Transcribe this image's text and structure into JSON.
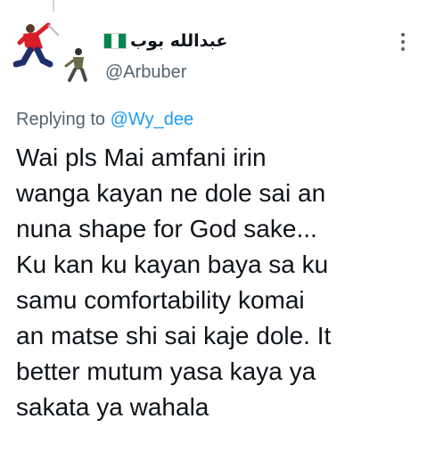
{
  "author": {
    "display_name": "عبدالله بوب",
    "flag_icon": "nigeria-flag-icon",
    "handle": "@Arbuber",
    "avatar_icon": "avatar-illustration-icon"
  },
  "menu": {
    "icon": "more-options-icon"
  },
  "reply_context": {
    "prefix": "Replying to",
    "mention": "@Wy_dee"
  },
  "tweet": {
    "lines": [
      "Wai pls Mai amfani irin",
      "wanga kayan ne dole sai an",
      "nuna shape for God sake...",
      "Ku kan ku kayan baya sa ku",
      "samu comfortability komai",
      "an matse shi sai kaje dole. It",
      "better mutum yasa kaya ya",
      "sakata ya wahala"
    ]
  },
  "colors": {
    "text_primary": "#0f1419",
    "text_secondary": "#536471",
    "link": "#1d9bf0",
    "flag_green": "#008751"
  }
}
